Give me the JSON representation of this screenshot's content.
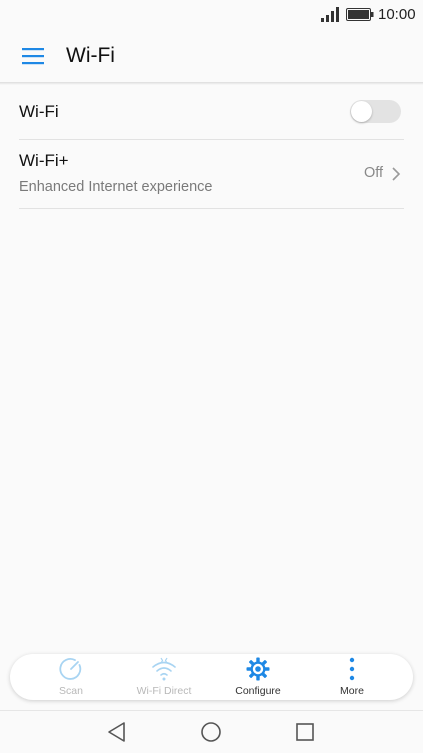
{
  "status_bar": {
    "time": "10:00",
    "icons": [
      "signal-icon",
      "battery-icon"
    ]
  },
  "app_bar": {
    "title": "Wi-Fi",
    "menu_icon": "menu-icon"
  },
  "settings": {
    "wifi": {
      "label": "Wi-Fi",
      "enabled": false
    },
    "wifi_plus": {
      "title": "Wi-Fi+",
      "subtitle": "Enhanced Internet experience",
      "value": "Off"
    }
  },
  "actions": [
    {
      "label": "Scan",
      "icon": "scan-icon",
      "enabled": false
    },
    {
      "label": "Wi-Fi Direct",
      "icon": "wifi-direct-icon",
      "enabled": false
    },
    {
      "label": "Configure",
      "icon": "gear-icon",
      "enabled": true
    },
    {
      "label": "More",
      "icon": "more-vertical-icon",
      "enabled": true
    }
  ],
  "nav_bar": {
    "buttons": [
      "back-icon",
      "home-icon",
      "recents-icon"
    ]
  },
  "colors": {
    "accent": "#1e88e5",
    "disabled_accent": "#a8d4f2",
    "background": "#fafafa",
    "toggle_off": "#e3e3e3"
  }
}
